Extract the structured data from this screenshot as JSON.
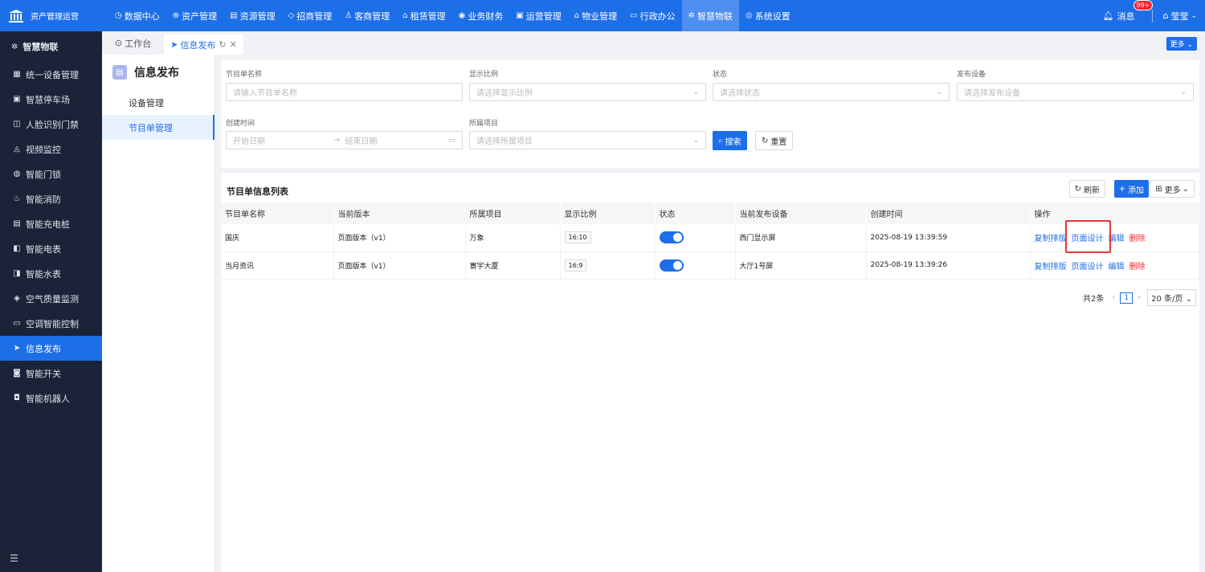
{
  "topbar": {
    "app_name": "资产管理运营",
    "nav": [
      {
        "icon": "◷",
        "label": "数据中心"
      },
      {
        "icon": "⊕",
        "label": "资产管理"
      },
      {
        "icon": "▤",
        "label": "资源管理"
      },
      {
        "icon": "◇",
        "label": "招商管理"
      },
      {
        "icon": "♙",
        "label": "客商管理"
      },
      {
        "icon": "⌂",
        "label": "租赁管理"
      },
      {
        "icon": "◉",
        "label": "业务财务"
      },
      {
        "icon": "▣",
        "label": "运营管理"
      },
      {
        "icon": "⌂",
        "label": "物业管理"
      },
      {
        "icon": "▭",
        "label": "行政办公"
      },
      {
        "icon": "✲",
        "label": "智慧物联"
      },
      {
        "icon": "◎",
        "label": "系统设置"
      }
    ],
    "active_index": 10,
    "messages_label": "消息",
    "badge": "99+",
    "user_name": "莹莹"
  },
  "sidebar": {
    "header": "智慧物联",
    "items": [
      {
        "icon": "▦",
        "label": "统一设备管理"
      },
      {
        "icon": "▣",
        "label": "智慧停车场"
      },
      {
        "icon": "◫",
        "label": "人脸识别门禁"
      },
      {
        "icon": "◬",
        "label": "视频监控"
      },
      {
        "icon": "◍",
        "label": "智能门锁"
      },
      {
        "icon": "♨",
        "label": "智能消防"
      },
      {
        "icon": "▤",
        "label": "智能充电桩"
      },
      {
        "icon": "◧",
        "label": "智能电表"
      },
      {
        "icon": "◨",
        "label": "智能水表"
      },
      {
        "icon": "◈",
        "label": "空气质量监测"
      },
      {
        "icon": "▭",
        "label": "空调智能控制"
      },
      {
        "icon": "➤",
        "label": "信息发布"
      },
      {
        "icon": "◙",
        "label": "智能开关"
      },
      {
        "icon": "◘",
        "label": "智能机器人"
      }
    ],
    "active_index": 11,
    "collapse_icon": "☰"
  },
  "tabs": {
    "workbench": "工作台",
    "current": "信息发布",
    "more": "更多"
  },
  "submenu": {
    "title": "信息发布",
    "items": [
      "设备管理",
      "节目单管理"
    ],
    "active_index": 1
  },
  "filter": {
    "name_label": "节目单名称",
    "name_placeholder": "请输入节目单名称",
    "ratio_label": "显示比例",
    "ratio_placeholder": "请选择显示比例",
    "status_label": "状态",
    "status_placeholder": "请选择状态",
    "device_label": "发布设备",
    "device_placeholder": "请选择发布设备",
    "created_label": "创建时间",
    "start_placeholder": "开始日期",
    "end_placeholder": "结束日期",
    "project_label": "所属项目",
    "project_placeholder": "请选择所属项目",
    "search": "搜索",
    "reset": "重置"
  },
  "table": {
    "title": "节目单信息列表",
    "refresh": "刷新",
    "add": "添加",
    "more": "更多",
    "columns": [
      "节目单名称",
      "当前版本",
      "所属项目",
      "显示比例",
      "状态",
      "当前发布设备",
      "创建时间",
      "操作"
    ],
    "rows": [
      {
        "name": "国庆",
        "version": "页面版本（v1）",
        "project": "万象",
        "ratio": "16:10",
        "status_on": true,
        "device": "西门显示屏",
        "created": "2025-08-19 13:39:59"
      },
      {
        "name": "当月资讯",
        "version": "页面版本（v1）",
        "project": "寰宇大厦",
        "ratio": "16:9",
        "status_on": true,
        "device": "大厅1号屏",
        "created": "2025-08-19 13:39:26"
      }
    ],
    "actions": {
      "copy": "复制排版",
      "design": "页面设计",
      "edit": "编辑",
      "delete": "删除"
    }
  },
  "pagination": {
    "total": "共2条",
    "current_page": "1",
    "page_size": "20 条/页"
  },
  "colors": {
    "primary": "#1d6fe8",
    "sidebar_bg": "#1a2337",
    "danger": "#f5222d",
    "highlight": "#e53935"
  }
}
